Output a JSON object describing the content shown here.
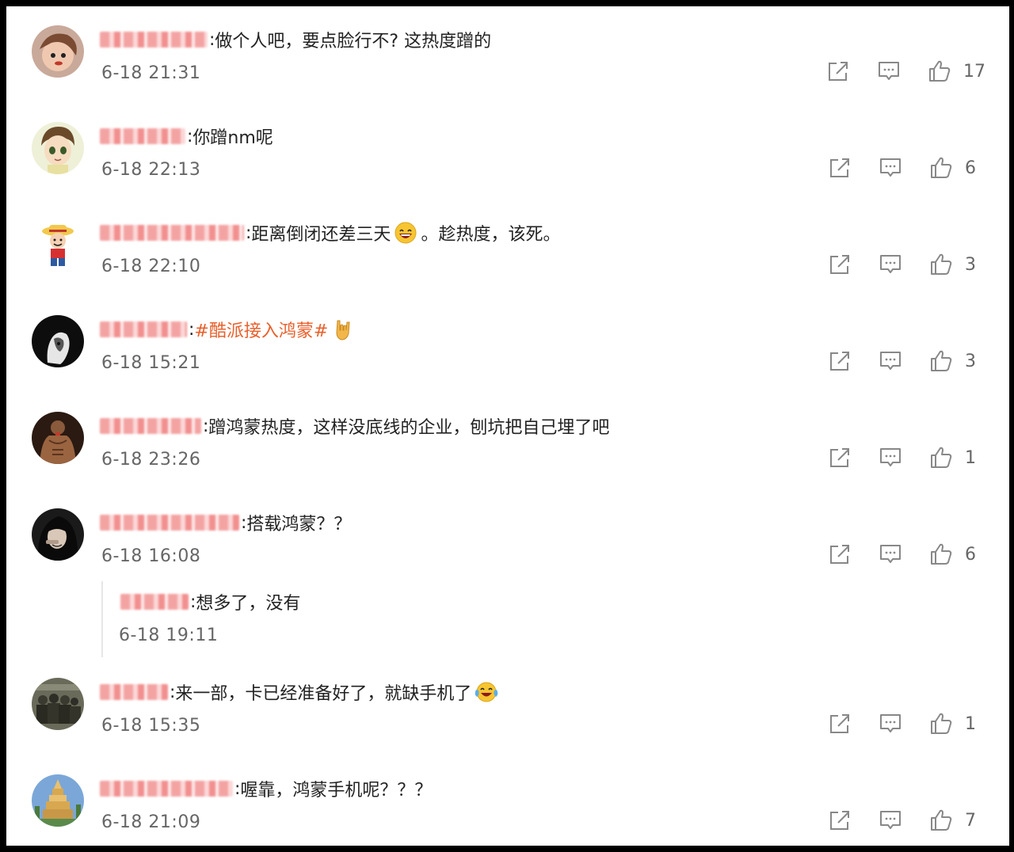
{
  "comments": [
    {
      "id": "c1",
      "avatar": "avatar-cartoon-boy-icon",
      "name_tint": "red",
      "text": "做个人吧，要点脸行不? 这热度蹭的",
      "emoji": null,
      "time": "6-18 21:31",
      "likes": "17"
    },
    {
      "id": "c2",
      "avatar": "avatar-anime-face-icon",
      "name_tint": "red",
      "text": "你蹭nm呢",
      "emoji": null,
      "time": "6-18 22:13",
      "likes": "6"
    },
    {
      "id": "c3",
      "avatar": "avatar-straw-hat-icon",
      "name_tint": "red",
      "text": "距离倒闭还差三天",
      "emoji": "laughing-face-emoji",
      "text_after": "。趁热度，该死。",
      "time": "6-18 22:10",
      "likes": "3"
    },
    {
      "id": "c4",
      "avatar": "avatar-dark-portrait-icon",
      "name_tint": "red",
      "text": "#酷派接入鸿蒙#",
      "text_is_link": true,
      "emoji": "rock-hand-emoji",
      "time": "6-18 15:21",
      "likes": "3"
    },
    {
      "id": "c5",
      "avatar": "avatar-muscle-man-icon",
      "name_tint": "red",
      "text": "蹭鸿蒙热度，这样没底线的企业，刨坑把自己埋了吧",
      "emoji": null,
      "time": "6-18 23:26",
      "likes": "1"
    },
    {
      "id": "c6",
      "avatar": "avatar-hooded-figure-icon",
      "name_tint": "red",
      "text": "搭载鸿蒙？？",
      "emoji": null,
      "time": "6-18 16:08",
      "likes": "6",
      "reply": {
        "name_tint": "red",
        "text": "想多了，没有",
        "time": "6-18 19:11"
      }
    },
    {
      "id": "c7",
      "avatar": "avatar-group-photo-icon",
      "name_tint": "red",
      "text": "来一部，卡已经准备好了，就缺手机了",
      "emoji": "tears-of-joy-emoji",
      "time": "6-18 15:35",
      "likes": "1"
    },
    {
      "id": "c8",
      "avatar": "avatar-temple-icon",
      "name_tint": "red",
      "text": "喔靠，鸿蒙手机呢？？？",
      "emoji": null,
      "time": "6-18 21:09",
      "likes": "7"
    }
  ],
  "colon": ":",
  "icons": {
    "share": "share-icon",
    "reply": "comment-icon",
    "like": "thumbs-up-icon"
  },
  "colors": {
    "text": "#222222",
    "time": "#666666",
    "icon": "#888888",
    "link": "#e8602c",
    "border": "#000000"
  }
}
